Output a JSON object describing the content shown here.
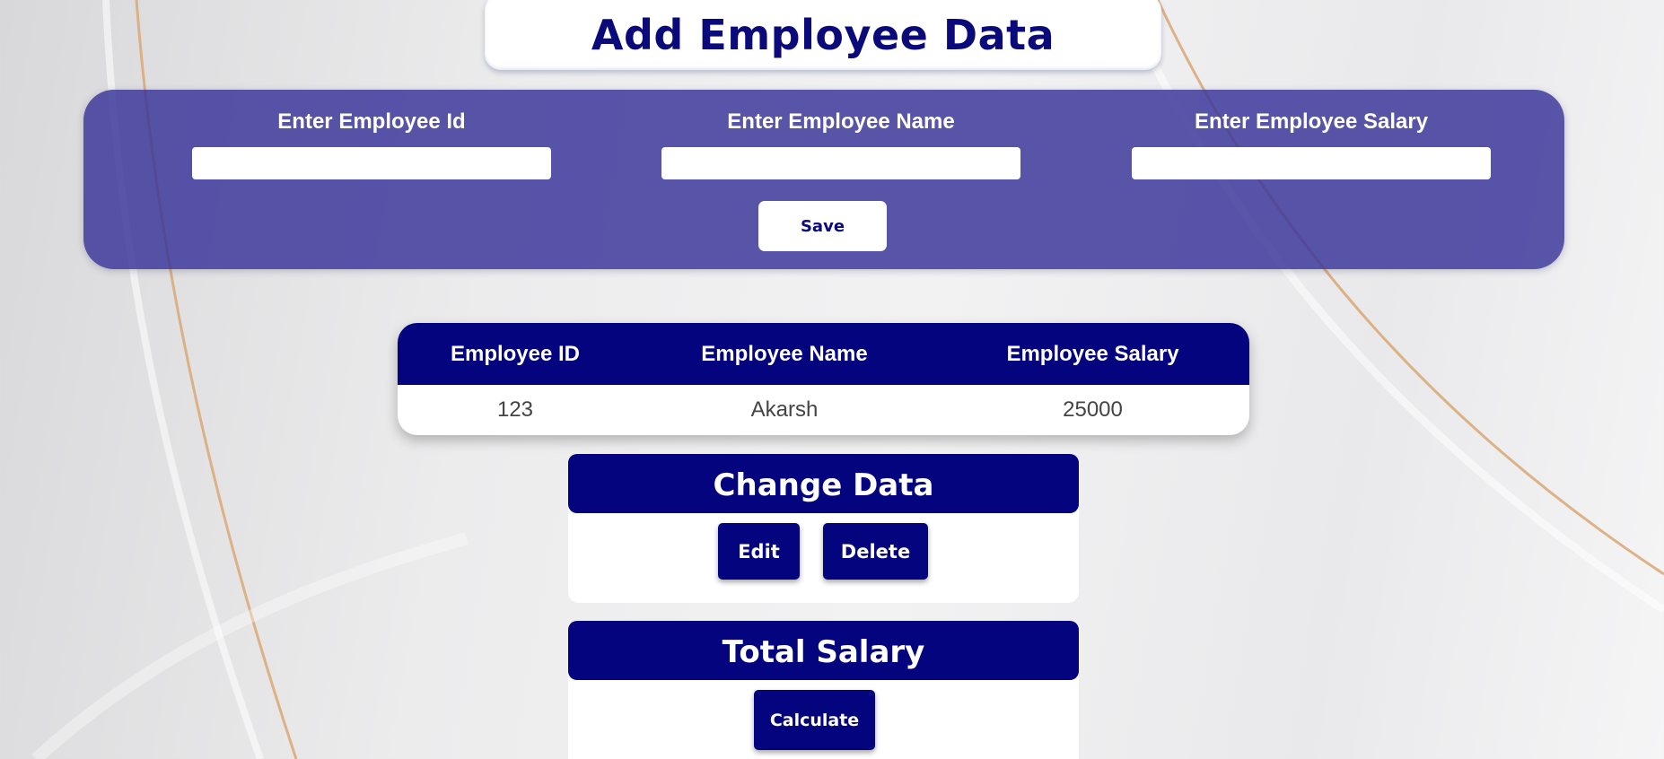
{
  "page": {
    "title": "Add Employee Data"
  },
  "form": {
    "id_label": "Enter Employee Id",
    "id_value": "",
    "name_label": "Enter Employee Name",
    "name_value": "",
    "salary_label": "Enter Employee Salary",
    "salary_value": "",
    "save_label": "Save"
  },
  "table": {
    "headers": [
      "Employee ID",
      "Employee Name",
      "Employee Salary"
    ],
    "rows": [
      [
        "123",
        "Akarsh",
        "25000"
      ]
    ]
  },
  "change_data": {
    "title": "Change Data",
    "edit_label": "Edit",
    "delete_label": "Delete"
  },
  "total_salary": {
    "title": "Total Salary",
    "calculate_label": "Calculate"
  },
  "colors": {
    "primary": "#04047e",
    "panel": "#3a369a",
    "accent_gold": "#d4a06a"
  }
}
